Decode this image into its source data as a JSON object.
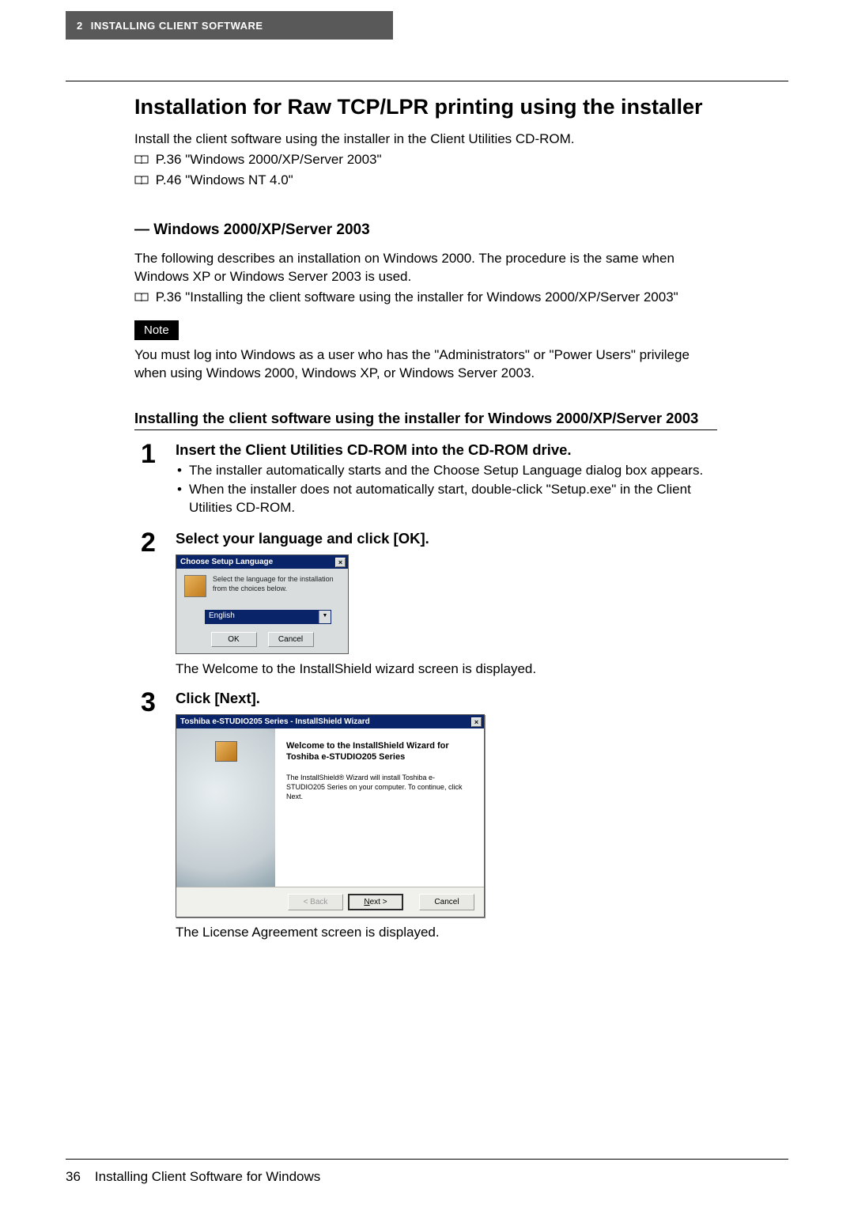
{
  "header": {
    "chapter": "2",
    "title": "INSTALLING CLIENT SOFTWARE"
  },
  "section_title": "Installation for Raw TCP/LPR printing using the installer",
  "intro": "Install the client software using the installer in the Client Utilities CD-ROM.",
  "ref1": "P.36 \"Windows 2000/XP/Server 2003\"",
  "ref2": "P.46 \"Windows NT 4.0\"",
  "sub_title": "— Windows 2000/XP/Server 2003",
  "sub_body": "The following describes an installation on Windows 2000. The procedure is the same when Windows XP or Windows Server 2003 is used.",
  "ref3": "P.36 \"Installing the client software using the installer for Windows 2000/XP/Server 2003\"",
  "note_label": "Note",
  "note_body": "You must log into Windows as a user who has the \"Administrators\" or \"Power Users\" privilege when using Windows 2000, Windows XP, or Windows Server 2003.",
  "proc_title": "Installing the client software using the installer for Windows 2000/XP/Server 2003",
  "steps": {
    "s1": {
      "num": "1",
      "head": "Insert the Client Utilities CD-ROM into the CD-ROM drive.",
      "b1": "The installer automatically starts and the Choose Setup Language dialog box appears.",
      "b2": "When the installer does not automatically start, double-click \"Setup.exe\" in the Client Utilities CD-ROM."
    },
    "s2": {
      "num": "2",
      "head": "Select your language and click [OK].",
      "after": "The Welcome to the InstallShield wizard screen is displayed."
    },
    "s3": {
      "num": "3",
      "head": "Click [Next].",
      "after": "The License Agreement screen is displayed."
    }
  },
  "dialog1": {
    "title": "Choose Setup Language",
    "msg": "Select the language for the installation from the choices below.",
    "selected": "English",
    "ok": "OK",
    "cancel": "Cancel"
  },
  "dialog2": {
    "title": "Toshiba e-STUDIO205 Series - InstallShield Wizard",
    "heading": "Welcome to the InstallShield Wizard for Toshiba e-STUDIO205 Series",
    "body": "The InstallShield® Wizard will install Toshiba e-STUDIO205 Series on your computer.  To continue, click Next.",
    "back": "< Back",
    "next": "Next >",
    "cancel": "Cancel"
  },
  "footer": {
    "page": "36",
    "text": "Installing Client Software for Windows"
  }
}
